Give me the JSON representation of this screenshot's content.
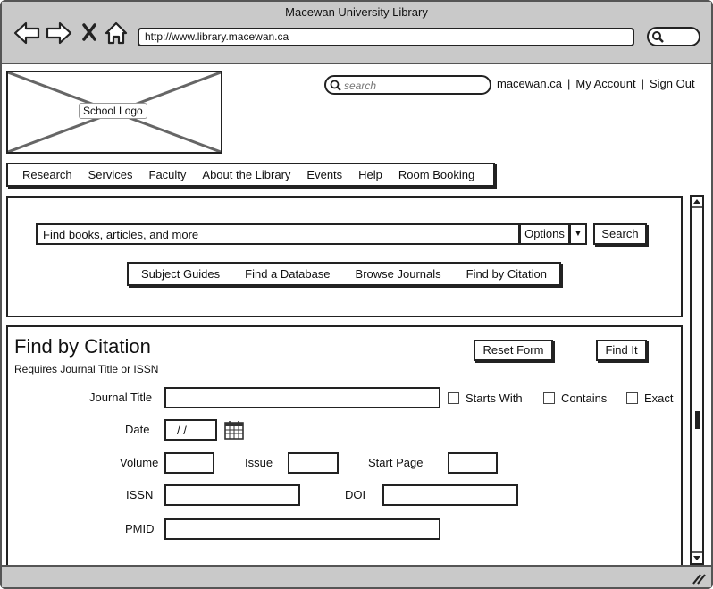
{
  "browser": {
    "title": "Macewan University Library",
    "url": "http://www.library.macewan.ca"
  },
  "header": {
    "logo_label": "School Logo",
    "search_placeholder": "search",
    "links": [
      "macewan.ca",
      "My Account",
      "Sign Out"
    ],
    "separator": "|"
  },
  "nav": {
    "items": [
      "Research",
      "Services",
      "Faculty",
      "About the Library",
      "Events",
      "Help",
      "Room Booking"
    ]
  },
  "search_panel": {
    "query_value": "Find books, articles, and more",
    "options_label": "Options",
    "search_label": "Search",
    "subnav": [
      "Subject Guides",
      "Find a Database",
      "Browse Journals",
      "Find by Citation"
    ]
  },
  "citation": {
    "title": "Find by Citation",
    "subtitle": "Requires Journal Title or ISSN",
    "reset_label": "Reset Form",
    "find_label": "Find It",
    "journal_title_label": "Journal Title",
    "match_options": [
      "Starts With",
      "Contains",
      "Exact"
    ],
    "date_label": "Date",
    "date_value": "/ /",
    "volume_label": "Volume",
    "issue_label": "Issue",
    "start_page_label": "Start Page",
    "issn_label": "ISSN",
    "doi_label": "DOI",
    "pmid_label": "PMID"
  }
}
